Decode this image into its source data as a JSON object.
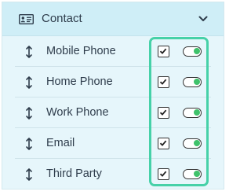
{
  "header": {
    "icon": "contact-card-icon",
    "title": "Contact",
    "toggle_icon": "chevron-down-icon"
  },
  "rows": [
    {
      "label": "Mobile Phone",
      "checked": true,
      "toggled": true
    },
    {
      "label": "Home Phone",
      "checked": true,
      "toggled": true
    },
    {
      "label": "Work Phone",
      "checked": true,
      "toggled": true
    },
    {
      "label": "Email",
      "checked": true,
      "toggled": true
    },
    {
      "label": "Third Party",
      "checked": true,
      "toggled": true
    }
  ],
  "icons": {
    "row_handle": "drag-handle-icon",
    "checkbox_mark": "checkmark-icon"
  },
  "colors": {
    "header_bg": "#cfeef7",
    "panel_bg": "#e6f6fb",
    "highlight": "#46d1a8",
    "toggle_on": "#3fc26b"
  }
}
